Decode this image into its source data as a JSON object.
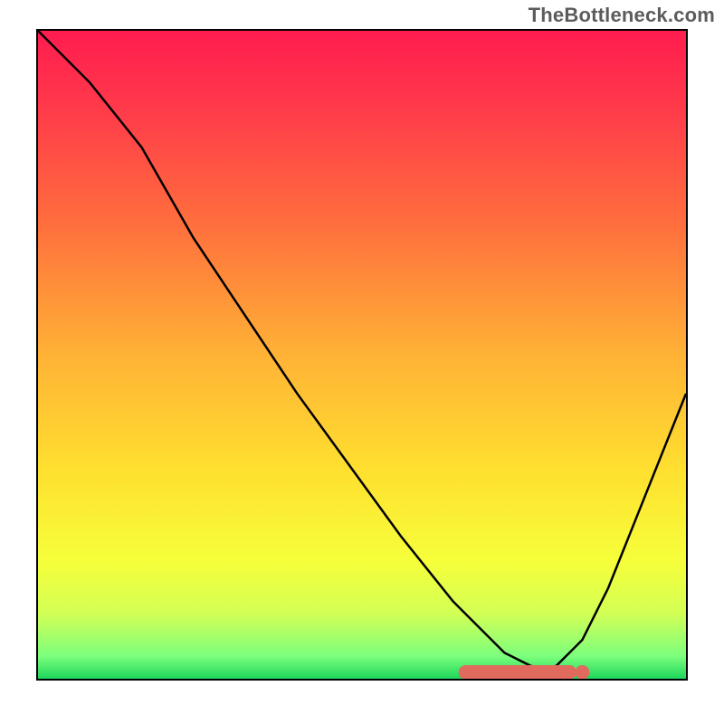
{
  "watermark": "TheBottleneck.com",
  "chart_data": {
    "type": "line",
    "title": "",
    "xlabel": "",
    "ylabel": "",
    "xlim": [
      0,
      100
    ],
    "ylim": [
      0,
      100
    ],
    "curve": {
      "x": [
        0,
        8,
        16,
        24,
        32,
        40,
        48,
        56,
        64,
        68,
        72,
        76,
        78,
        80,
        84,
        88,
        92,
        96,
        100
      ],
      "y": [
        100,
        92,
        82,
        68,
        56,
        44,
        33,
        22,
        12,
        8,
        4,
        2,
        1.5,
        2,
        6,
        14,
        24,
        34,
        44
      ]
    },
    "marker_band": {
      "x0": 66,
      "x1": 82,
      "y": 1.0,
      "thickness": 2.2
    },
    "marker_dot": {
      "x": 84,
      "y": 1.0,
      "r": 1.1
    },
    "gradient_stops": [
      {
        "offset": 0.0,
        "color": "#ff1c4f"
      },
      {
        "offset": 0.12,
        "color": "#ff3a4a"
      },
      {
        "offset": 0.3,
        "color": "#ff6f3d"
      },
      {
        "offset": 0.5,
        "color": "#ffb236"
      },
      {
        "offset": 0.68,
        "color": "#ffe02f"
      },
      {
        "offset": 0.82,
        "color": "#f6ff3b"
      },
      {
        "offset": 0.9,
        "color": "#d2ff55"
      },
      {
        "offset": 0.965,
        "color": "#7dff7d"
      },
      {
        "offset": 1.0,
        "color": "#1dd65a"
      }
    ],
    "colors": {
      "curve": "#000000",
      "marker": "#e06a5e"
    }
  }
}
